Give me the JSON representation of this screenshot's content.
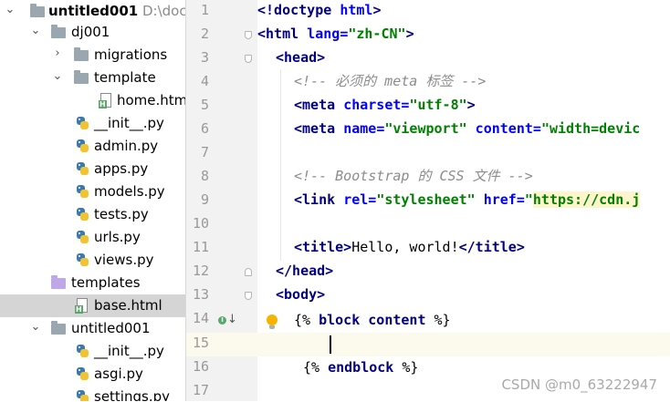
{
  "tree": {
    "root_label": "untitled001",
    "root_path": "D:\\docu",
    "items": [
      {
        "label": "dj001"
      },
      {
        "label": "migrations"
      },
      {
        "label": "template"
      },
      {
        "label": "home.htm"
      },
      {
        "label": "__init__.py"
      },
      {
        "label": "admin.py"
      },
      {
        "label": "apps.py"
      },
      {
        "label": "models.py"
      },
      {
        "label": "tests.py"
      },
      {
        "label": "urls.py"
      },
      {
        "label": "views.py"
      },
      {
        "label": "templates"
      },
      {
        "label": "base.html"
      },
      {
        "label": "untitled001"
      },
      {
        "label": "__init__.py"
      },
      {
        "label": "asgi.py"
      },
      {
        "label": "settings.py"
      }
    ]
  },
  "editor": {
    "line_numbers": [
      "1",
      "2",
      "3",
      "4",
      "5",
      "6",
      "7",
      "8",
      "9",
      "10",
      "11",
      "12",
      "13",
      "14",
      "15",
      "16",
      "17"
    ],
    "current_line": "15",
    "tokens": {
      "l1": [
        "<!doctype ",
        "html",
        ">"
      ],
      "l2": [
        "<html ",
        "lang",
        "=",
        "\"zh-CN\"",
        ">"
      ],
      "l3": [
        "<head>"
      ],
      "l4": [
        "<!-- 必须的 meta 标签 -->"
      ],
      "l5": [
        "<meta ",
        "charset",
        "=",
        "\"utf-8\"",
        ">"
      ],
      "l6": [
        "<meta ",
        "name",
        "=",
        "\"viewport\"",
        " content",
        "=",
        "\"width=devic"
      ],
      "l8": [
        "<!-- Bootstrap 的 CSS 文件 -->"
      ],
      "l9": [
        "<link ",
        "rel",
        "=",
        "\"stylesheet\"",
        " href",
        "=",
        "\"",
        "https://cdn.j"
      ],
      "l11": [
        "<title>",
        "Hello, world!",
        "</title>"
      ],
      "l12": [
        "</head>"
      ],
      "l13": [
        "<body>"
      ],
      "l14": [
        "{% ",
        "block content",
        " %}"
      ],
      "l16": [
        "{% ",
        "endblock",
        " %}"
      ]
    }
  },
  "watermark": "CSDN @m0_63222947",
  "colors": {
    "tag": "#000080",
    "attribute": "#0000ff",
    "string": "#008000",
    "comment": "#8c8c8c",
    "current_line": "#fcfaed",
    "gutter": "#f2f2f2",
    "selection": "#d5d5d5"
  },
  "icons": {
    "folder": "folder-icon",
    "python_file": "python-file-icon",
    "html_file": "html-file-icon",
    "intention_bulb": "lightbulb-icon",
    "implemented_marker": "implemented-marker-icon"
  }
}
